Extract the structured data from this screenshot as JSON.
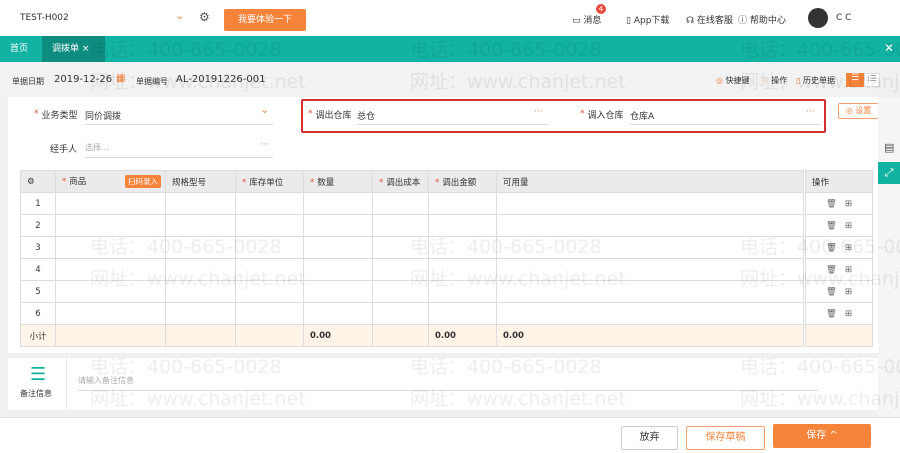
{
  "topbar": {
    "account": "TEST-H002",
    "trial_button": "我要体验一下",
    "messages": "消息",
    "message_badge": "4",
    "app_download": "App下载",
    "online_service": "在线客服",
    "help_center": "帮助中心",
    "user": "C C"
  },
  "tabs": [
    {
      "label": "首页"
    },
    {
      "label": "调拨单",
      "close": "×"
    }
  ],
  "toolbar": {
    "date_label": "单据日期",
    "date": "2019-12-26",
    "number_label": "单据编号",
    "number": "AL-20191226-001",
    "shortcuts": "快捷键",
    "operations": "操作",
    "history": "历史单据"
  },
  "form": {
    "biz_type_label": "业务类型",
    "biz_type": "同价调拨",
    "out_wh_label": "调出仓库",
    "out_wh": "总仓",
    "in_wh_label": "调入仓库",
    "in_wh": "仓库A",
    "handler_label": "经手人",
    "handler_placeholder": "选择...",
    "settings": "设置",
    "more": "···"
  },
  "table": {
    "headers": [
      "商品",
      "规格型号",
      "库存单位",
      "数量",
      "调出成本",
      "调出金额",
      "可用量",
      "操作"
    ],
    "scan_button": "扫码录入",
    "rows": [
      "1",
      "2",
      "3",
      "4",
      "5",
      "6"
    ],
    "subtotal_label": "小计",
    "subtotal_qty": "0.00",
    "subtotal_amount": "0.00",
    "subtotal_available": "0.00"
  },
  "remark": {
    "label": "备注信息",
    "placeholder": "请输入备注信息"
  },
  "footer": {
    "discard": "放弃",
    "save_draft": "保存草稿",
    "save": "保存 ^"
  },
  "watermark": {
    "phone": "电话：400-665-0028",
    "site": "网址：www.chanjet.net"
  },
  "colors": {
    "teal": "#13b3a3",
    "orange": "#f5833a",
    "highlight": "#d32f2f"
  }
}
